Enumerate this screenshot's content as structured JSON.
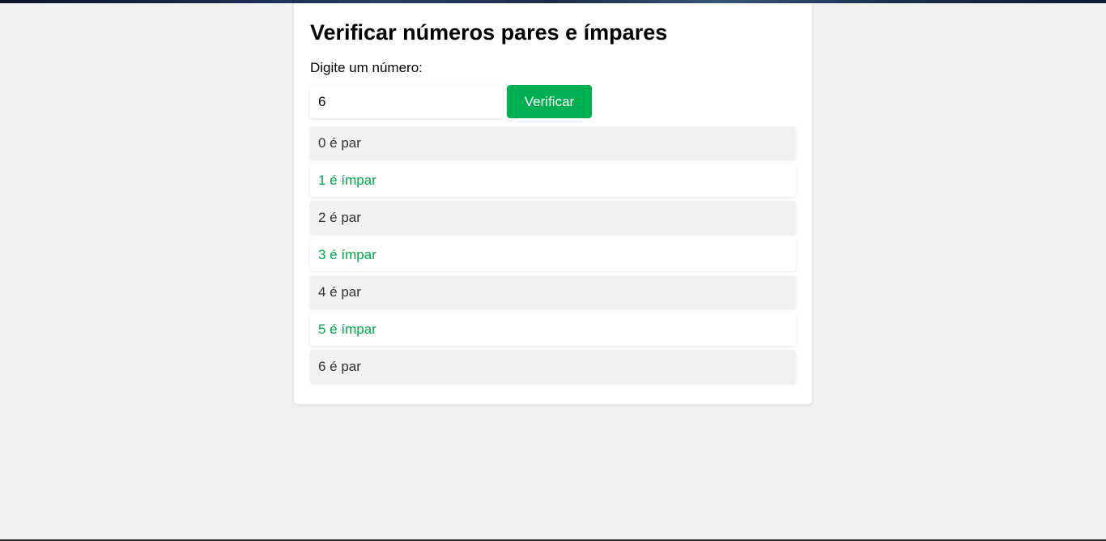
{
  "page": {
    "title": "Verificar números pares e ímpares",
    "input_label": "Digite um número:"
  },
  "form": {
    "input_value": "6",
    "button_label": "Verificar"
  },
  "results": [
    {
      "text": "0 é par",
      "kind": "par"
    },
    {
      "text": "1 é ímpar",
      "kind": "impar"
    },
    {
      "text": "2 é par",
      "kind": "par"
    },
    {
      "text": "3 é ímpar",
      "kind": "impar"
    },
    {
      "text": "4 é par",
      "kind": "par"
    },
    {
      "text": "5 é ímpar",
      "kind": "impar"
    },
    {
      "text": "6 é par",
      "kind": "par"
    }
  ],
  "colors": {
    "accent": "#00b050",
    "odd_text": "#00a64b",
    "even_text": "#333333",
    "even_background": "#f1f1f1",
    "page_background": "#f1f1f1"
  }
}
